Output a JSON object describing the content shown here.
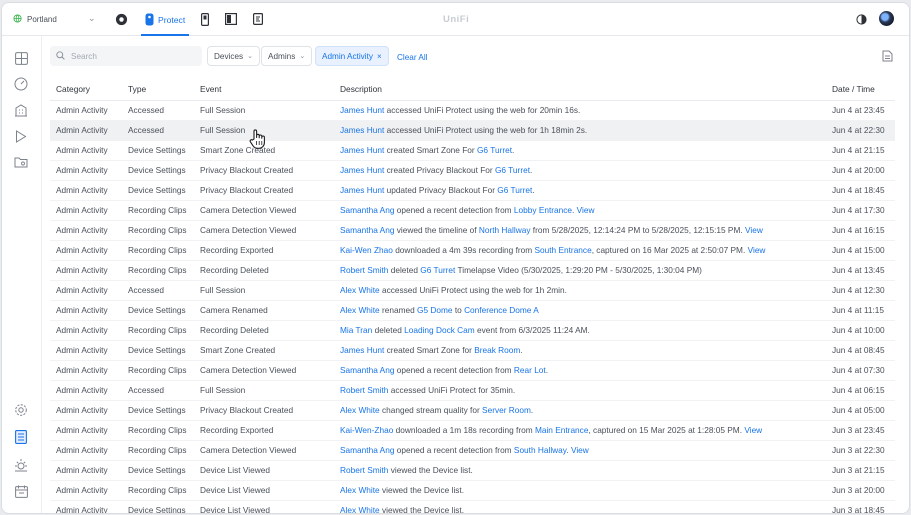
{
  "app": {
    "brand": "UniFi",
    "site": "Portland",
    "active_tab": "Protect"
  },
  "toolbar": {
    "search_placeholder": "Search",
    "filters": [
      {
        "label": "Devices",
        "active": false
      },
      {
        "label": "Admins",
        "active": false
      },
      {
        "label": "Admin Activity",
        "active": true
      }
    ],
    "clear_all": "Clear All"
  },
  "table": {
    "columns": [
      "Category",
      "Type",
      "Event",
      "Description",
      "Date / Time"
    ],
    "rows": [
      {
        "category": "Admin Activity",
        "type": "Accessed",
        "event": "Full Session",
        "desc": [
          [
            "James Hunt",
            true
          ],
          [
            " accessed UniFi Protect using the web for 20min 16s.",
            false
          ]
        ],
        "date": "Jun 4 at 23:45"
      },
      {
        "category": "Admin Activity",
        "type": "Accessed",
        "event": "Full Session",
        "desc": [
          [
            "James Hunt",
            true
          ],
          [
            " accessed UniFi Protect using the web for 1h 18min 2s.",
            false
          ]
        ],
        "date": "Jun 4 at 22:30",
        "highlight": true
      },
      {
        "category": "Admin Activity",
        "type": "Device Settings",
        "event": "Smart Zone Created",
        "desc": [
          [
            "James Hunt",
            true
          ],
          [
            " created Smart Zone For ",
            false
          ],
          [
            "G6 Turret",
            true
          ],
          [
            ".",
            false
          ]
        ],
        "date": "Jun 4 at 21:15"
      },
      {
        "category": "Admin Activity",
        "type": "Device Settings",
        "event": "Privacy Blackout Created",
        "desc": [
          [
            "James Hunt",
            true
          ],
          [
            " created Privacy Blackout For ",
            false
          ],
          [
            "G6 Turret",
            true
          ],
          [
            ".",
            false
          ]
        ],
        "date": "Jun 4 at 20:00"
      },
      {
        "category": "Admin Activity",
        "type": "Device Settings",
        "event": "Privacy Blackout Created",
        "desc": [
          [
            "James Hunt",
            true
          ],
          [
            " updated Privacy Blackout For ",
            false
          ],
          [
            "G6 Turret",
            true
          ],
          [
            ".",
            false
          ]
        ],
        "date": "Jun 4 at 18:45"
      },
      {
        "category": "Admin Activity",
        "type": "Recording Clips",
        "event": "Camera Detection Viewed",
        "desc": [
          [
            "Samantha Ang",
            true
          ],
          [
            " opened a recent detection from ",
            false
          ],
          [
            "Lobby Entrance",
            true
          ],
          [
            ". ",
            false
          ],
          [
            "View",
            true
          ]
        ],
        "date": "Jun 4 at 17:30"
      },
      {
        "category": "Admin Activity",
        "type": "Recording Clips",
        "event": "Camera Detection Viewed",
        "desc": [
          [
            "Samantha Ang",
            true
          ],
          [
            " viewed the timeline of ",
            false
          ],
          [
            "North Hallway",
            true
          ],
          [
            " from 5/28/2025, 12:14:24 PM to 5/28/2025, 12:15:15 PM. ",
            false
          ],
          [
            "View",
            true
          ]
        ],
        "date": "Jun 4 at 16:15"
      },
      {
        "category": "Admin Activity",
        "type": "Recording Clips",
        "event": "Recording Exported",
        "desc": [
          [
            "Kai-Wen Zhao",
            true
          ],
          [
            " downloaded a 4m 39s recording from ",
            false
          ],
          [
            "South Entrance",
            true
          ],
          [
            ", captured on 16 Mar 2025 at 2:50:07 PM. ",
            false
          ],
          [
            "View",
            true
          ]
        ],
        "date": "Jun 4 at 15:00"
      },
      {
        "category": "Admin Activity",
        "type": "Recording Clips",
        "event": "Recording Deleted",
        "desc": [
          [
            "Robert Smith",
            true
          ],
          [
            " deleted ",
            false
          ],
          [
            "G6 Turret",
            true
          ],
          [
            " Timelapse Video (5/30/2025, 1:29:20 PM - 5/30/2025, 1:30:04 PM)",
            false
          ]
        ],
        "date": "Jun 4 at 13:45"
      },
      {
        "category": "Admin Activity",
        "type": "Accessed",
        "event": "Full Session",
        "desc": [
          [
            "Alex White",
            true
          ],
          [
            " accessed UniFi Protect using the web for 1h 2min.",
            false
          ]
        ],
        "date": "Jun 4 at 12:30"
      },
      {
        "category": "Admin Activity",
        "type": "Device Settings",
        "event": "Camera Renamed",
        "desc": [
          [
            "Alex White",
            true
          ],
          [
            " renamed ",
            false
          ],
          [
            "G5 Dome",
            true
          ],
          [
            " to ",
            false
          ],
          [
            "Conference Dome A",
            true
          ]
        ],
        "date": "Jun 4 at 11:15"
      },
      {
        "category": "Admin Activity",
        "type": "Recording Clips",
        "event": "Recording Deleted",
        "desc": [
          [
            "Mia Tran",
            true
          ],
          [
            " deleted ",
            false
          ],
          [
            "Loading Dock Cam",
            true
          ],
          [
            " event from 6/3/2025 11:24 AM.",
            false
          ]
        ],
        "date": "Jun 4 at 10:00"
      },
      {
        "category": "Admin Activity",
        "type": "Device Settings",
        "event": "Smart Zone Created",
        "desc": [
          [
            "James Hunt",
            true
          ],
          [
            " created Smart Zone for ",
            false
          ],
          [
            "Break Room",
            true
          ],
          [
            ".",
            false
          ]
        ],
        "date": "Jun 4 at 08:45"
      },
      {
        "category": "Admin Activity",
        "type": "Recording Clips",
        "event": "Camera Detection Viewed",
        "desc": [
          [
            "Samantha Ang",
            true
          ],
          [
            " opened a recent detection from ",
            false
          ],
          [
            "Rear Lot",
            true
          ],
          [
            ".",
            false
          ]
        ],
        "date": "Jun 4 at 07:30"
      },
      {
        "category": "Admin Activity",
        "type": "Accessed",
        "event": "Full Session",
        "desc": [
          [
            "Robert Smith",
            true
          ],
          [
            " accessed UniFi Protect for 35min.",
            false
          ]
        ],
        "date": "Jun 4 at 06:15"
      },
      {
        "category": "Admin Activity",
        "type": "Device Settings",
        "event": "Privacy Blackout Created",
        "desc": [
          [
            "Alex White",
            true
          ],
          [
            " changed stream quality for ",
            false
          ],
          [
            "Server Room",
            true
          ],
          [
            ".",
            false
          ]
        ],
        "date": "Jun 4 at 05:00"
      },
      {
        "category": "Admin Activity",
        "type": "Recording Clips",
        "event": "Recording Exported",
        "desc": [
          [
            "Kai-Wen-Zhao",
            true
          ],
          [
            " downloaded a 1m 18s recording from ",
            false
          ],
          [
            "Main Entrance",
            true
          ],
          [
            ", captured on 15 Mar 2025 at 1:28:05 PM. ",
            false
          ],
          [
            "View",
            true
          ]
        ],
        "date": "Jun 3 at 23:45"
      },
      {
        "category": "Admin Activity",
        "type": "Recording Clips",
        "event": "Camera Detection Viewed",
        "desc": [
          [
            "Samantha Ang",
            true
          ],
          [
            " opened a recent detection from ",
            false
          ],
          [
            "South Hallway",
            true
          ],
          [
            ". ",
            false
          ],
          [
            "View",
            true
          ]
        ],
        "date": "Jun 3 at 22:30"
      },
      {
        "category": "Admin Activity",
        "type": "Device Settings",
        "event": "Device List Viewed",
        "desc": [
          [
            "Robert Smith",
            true
          ],
          [
            " viewed the Device list.",
            false
          ]
        ],
        "date": "Jun 3 at 21:15"
      },
      {
        "category": "Admin Activity",
        "type": "Recording Clips",
        "event": "Device List Viewed",
        "desc": [
          [
            "Alex White",
            true
          ],
          [
            " viewed the Device list.",
            false
          ]
        ],
        "date": "Jun 3 at 20:00"
      },
      {
        "category": "Admin Activity",
        "type": "Device Settings",
        "event": "Device List Viewed",
        "desc": [
          [
            "Alex White",
            true
          ],
          [
            " viewed the Device list.",
            false
          ]
        ],
        "date": "Jun 3 at 18:45"
      }
    ]
  },
  "colors": {
    "accent": "#1874e8",
    "row_highlight": "#f0f1f3"
  },
  "icons": {
    "topbar": [
      "globe-icon",
      "chevron-down-icon",
      "protect-app-icon",
      "camera-icon",
      "phone-icon",
      "door-icon",
      "tablet-icon",
      "theme-toggle-icon",
      "avatar"
    ],
    "sidebar": [
      "grid-icon",
      "dashboard-icon",
      "building-icon",
      "play-icon",
      "folder-icon",
      "settings-icon",
      "logs-icon",
      "sun-icon",
      "calendar-icon"
    ]
  }
}
